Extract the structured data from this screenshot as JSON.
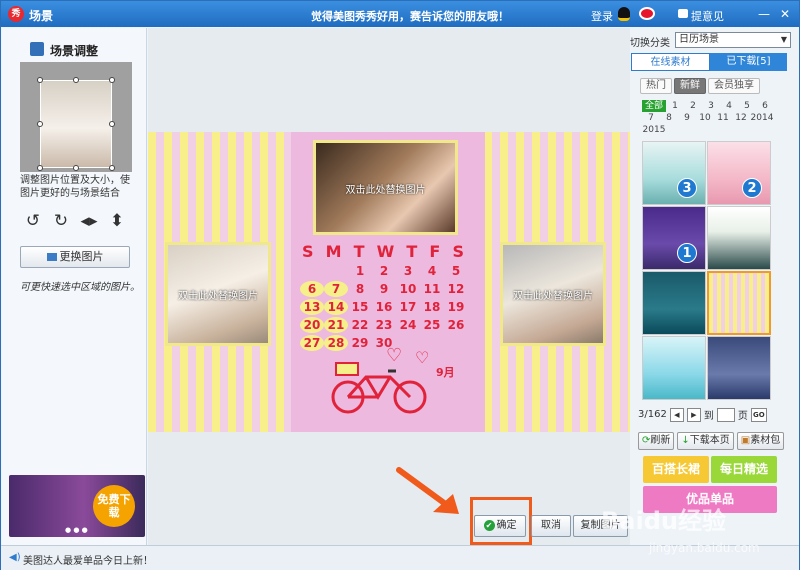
{
  "window": {
    "app_logo": "秀",
    "title": "场景",
    "slogan": "觉得美图秀秀好用，赛告诉您的朋友哦！",
    "login": "登录",
    "feedback": "提意见",
    "minimize_glyph": "—",
    "close_glyph": "✕"
  },
  "left_panel": {
    "title": "场景调整",
    "hint": "调整图片位置及大小，使图片更好的与场景结合",
    "change_button": "更换图片",
    "tip": "可更快速选中区域的图片。",
    "ad_badge": "免费下载",
    "ad_dots": "● ● ●"
  },
  "canvas": {
    "photo_placeholder": "双击此处替换图片",
    "calendar_header": [
      "S",
      "M",
      "T",
      "W",
      "T",
      "F",
      "S"
    ],
    "calendar_days": [
      "",
      "",
      "",
      "",
      "",
      "",
      "",
      "",
      "1",
      "2",
      "3",
      "4",
      "5",
      "6",
      "7",
      "8",
      "9",
      "10",
      "11",
      "12",
      "13",
      "14",
      "15",
      "16",
      "17",
      "18",
      "19",
      "20",
      "21",
      "22",
      "23",
      "24",
      "25",
      "26",
      "27",
      "28",
      "29",
      "30",
      "",
      "",
      "",
      ""
    ],
    "highlighted_days": [
      "6",
      "7",
      "13",
      "14",
      "20",
      "21",
      "27",
      "28"
    ],
    "bike_date": "9月"
  },
  "buttons": {
    "confirm": "确定",
    "confirm_check": "✔",
    "cancel": "取消",
    "copy": "复制图片"
  },
  "right_panel": {
    "switch_label": "切换分类",
    "category": "日历场景",
    "tab_online": "在线素材",
    "tab_downloaded": "已下载[5]",
    "filters": [
      "热门",
      "新鲜",
      "会员独享"
    ],
    "active_filter": "新鲜",
    "months": [
      "全部",
      "1",
      "2",
      "3",
      "4",
      "5",
      "6",
      "7",
      "8",
      "9",
      "10",
      "11",
      "12",
      "2014",
      "2015"
    ],
    "active_month": "全部",
    "thumb_badges": [
      "3",
      "2",
      "1"
    ],
    "page_info": "3/162",
    "goto_label": "到",
    "page_unit": "页",
    "go_label": "GO",
    "refresh": "刷新",
    "download_page": "下载本页",
    "material_pack": "素材包",
    "promos": [
      "百搭长裙",
      "每日精选",
      "优品单品"
    ]
  },
  "status": {
    "text": "美图达人最爱单品今日上新！"
  },
  "watermark": {
    "text": "Baidu经验",
    "url": "jingyan.baidu.com"
  },
  "colors": {
    "titlebar": "#2f7ccf",
    "accent_orange": "#f05a1a",
    "calendar_red": "#e0223a",
    "highlight_yellow": "#f6f08a",
    "stripe_pink": "#f1cfe4",
    "stripe_yellow": "#f9ef8a",
    "card_pink": "#eeb9df",
    "green": "#27a12f"
  },
  "icons": [
    "app-logo-icon",
    "scene-icon",
    "qq-icon",
    "weibo-icon",
    "feedback-icon",
    "rotate-left-icon",
    "rotate-right-icon",
    "flip-horizontal-icon",
    "flip-vertical-icon",
    "picture-icon",
    "check-icon",
    "prev-page-icon",
    "next-page-icon",
    "refresh-icon",
    "download-icon",
    "package-icon",
    "speaker-icon",
    "arrow-icon"
  ]
}
